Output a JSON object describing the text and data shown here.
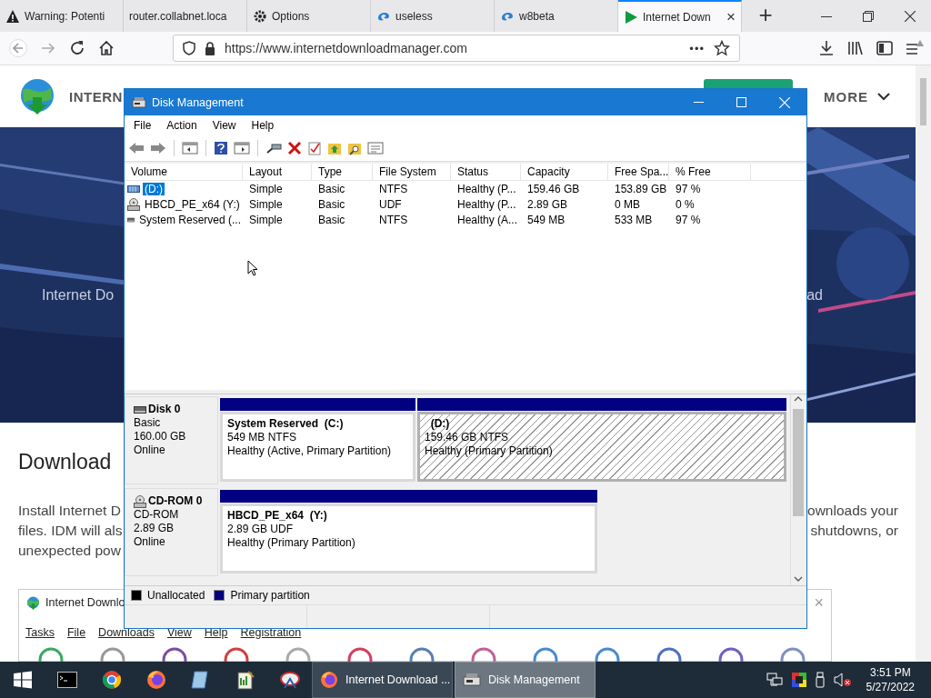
{
  "browser": {
    "tabs": [
      {
        "title": "Warning: Potenti",
        "selected": false
      },
      {
        "title": "router.collabnet.loca",
        "selected": false
      },
      {
        "title": "Options",
        "selected": false
      },
      {
        "title": "useless",
        "selected": false
      },
      {
        "title": "w8beta",
        "selected": false
      },
      {
        "title": "Internet Down",
        "selected": true,
        "close": "×"
      }
    ],
    "new_tab": "+",
    "address": "https://www.internetdownloadmanager.com",
    "more": "•••"
  },
  "page": {
    "brand": "INTERN",
    "more": "MORE",
    "banner_left": "Internet Do",
    "banner_right": "ad",
    "heading": "Download",
    "paragraph_left": [
      "Install Internet D",
      "files. IDM will als",
      "unexpected pow"
    ],
    "paragraph_right": [
      "ownloads your",
      "shutdowns, or"
    ],
    "app_window": {
      "title": "Internet Downlo",
      "close": "×",
      "menu": [
        "Tasks",
        "File",
        "Downloads",
        "View",
        "Help",
        "Registration"
      ]
    }
  },
  "disk_management": {
    "title": "Disk Management",
    "menu": [
      "File",
      "Action",
      "View",
      "Help"
    ],
    "columns": [
      "Volume",
      "Layout",
      "Type",
      "File System",
      "Status",
      "Capacity",
      "Free Spa...",
      "% Free"
    ],
    "volumes": [
      {
        "selected": true,
        "cells": [
          "(D:)",
          "Simple",
          "Basic",
          "NTFS",
          "Healthy (P...",
          "159.46 GB",
          "153.89 GB",
          "97 %"
        ]
      },
      {
        "selected": false,
        "cells": [
          "HBCD_PE_x64 (Y:)",
          "Simple",
          "Basic",
          "UDF",
          "Healthy (P...",
          "2.89 GB",
          "0 MB",
          "0 %"
        ]
      },
      {
        "selected": false,
        "cells": [
          "System Reserved (...",
          "Simple",
          "Basic",
          "NTFS",
          "Healthy (A...",
          "549 MB",
          "533 MB",
          "97 %"
        ]
      }
    ],
    "disks": [
      {
        "name": "Disk 0",
        "lines": [
          "Basic",
          "160.00 GB",
          "Online"
        ],
        "partitions": [
          {
            "name": "System Reserved  (C:)",
            "size": "549 MB NTFS",
            "status": "Healthy (Active, Primary Partition)",
            "selected": false
          },
          {
            "name": "  (D:)",
            "size": "159.46 GB NTFS",
            "status": "Healthy (Primary Partition)",
            "selected": true
          }
        ]
      },
      {
        "name": "CD-ROM 0",
        "lines": [
          "CD-ROM",
          "2.89 GB",
          "Online"
        ],
        "partitions": [
          {
            "name": "HBCD_PE_x64  (Y:)",
            "size": "2.89 GB UDF",
            "status": "Healthy (Primary Partition)",
            "selected": false
          }
        ]
      }
    ],
    "legend": [
      {
        "label": "Unallocated",
        "color": "#000000"
      },
      {
        "label": "Primary partition",
        "color": "#000080"
      }
    ]
  },
  "taskbar": {
    "windows": [
      {
        "label": "Internet Download ...",
        "selected": false
      },
      {
        "label": "Disk Management",
        "selected": true
      }
    ],
    "time": "3:51 PM",
    "date": "5/27/2022"
  }
}
